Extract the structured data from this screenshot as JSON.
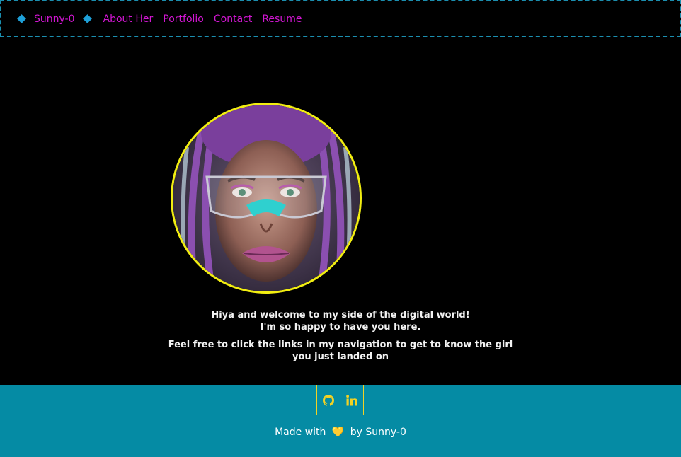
{
  "nav": {
    "brand": "Sunny-0",
    "links": [
      "About Her",
      "Portfolio",
      "Contact",
      "Resume"
    ]
  },
  "colors": {
    "link": "#d316d3",
    "nav_border": "#1b8fb0",
    "avatar_border": "#f2ee11",
    "footer_bg": "#058ba4",
    "social_icon": "#f2d224"
  },
  "hero": {
    "avatar_alt": "portrait",
    "line1": "Hiya and welcome to my side of the digital world!",
    "line2": "I'm so happy to have you here.",
    "line3": "Feel free to click the links in my navigation to get to know the girl you just landed on"
  },
  "footer": {
    "social_icons": [
      "github-icon",
      "linkedin-icon"
    ],
    "made_with": "Made with",
    "heart": "💛",
    "by": "by Sunny-0"
  }
}
